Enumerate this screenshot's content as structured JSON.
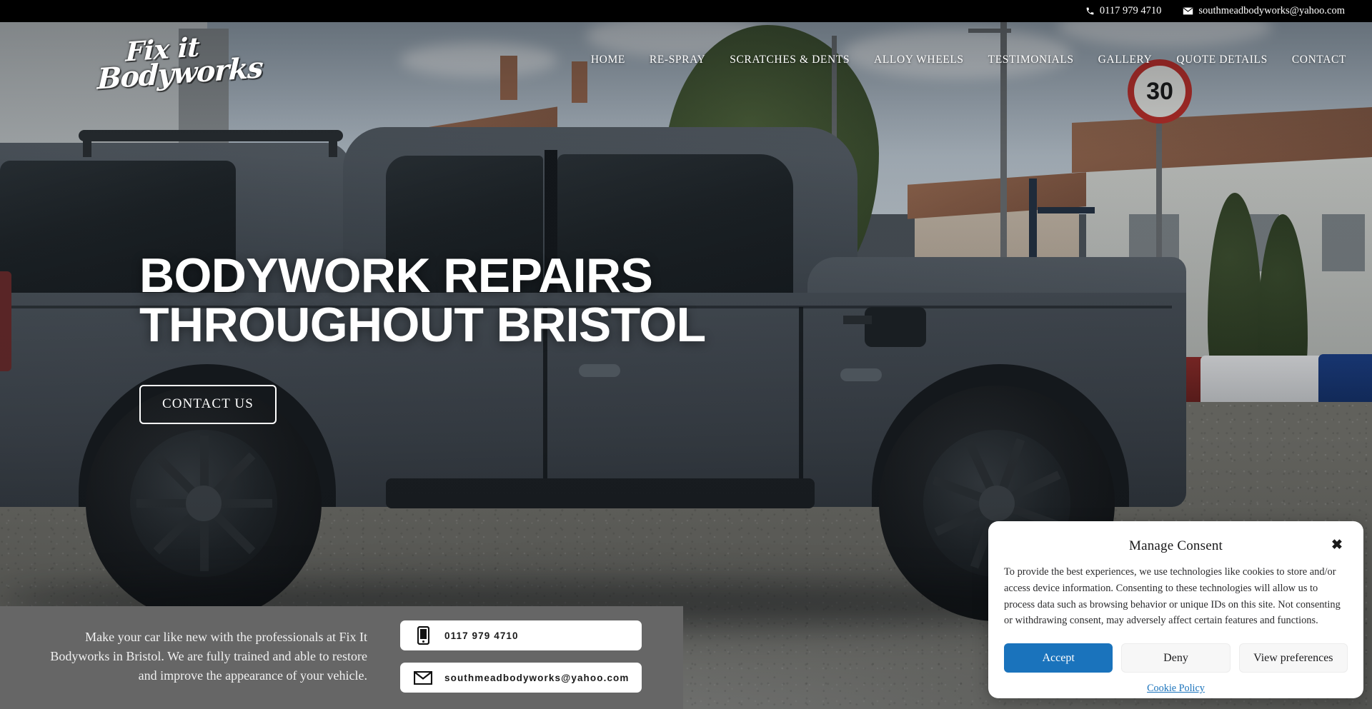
{
  "topbar": {
    "phone": "0117 979 4710",
    "email": "southmeadbodyworks@yahoo.com",
    "phone_icon": "phone-icon",
    "email_icon": "envelope-icon"
  },
  "header": {
    "logo_line1": "Fix it",
    "logo_line2": "Bodyworks",
    "nav": [
      {
        "label": "HOME"
      },
      {
        "label": "RE-SPRAY"
      },
      {
        "label": "SCRATCHES & DENTS"
      },
      {
        "label": "ALLOY WHEELS"
      },
      {
        "label": "TESTIMONIALS"
      },
      {
        "label": "GALLERY"
      },
      {
        "label": "QUOTE DETAILS"
      },
      {
        "label": "CONTACT"
      }
    ]
  },
  "hero": {
    "title_line1": "BODYWORK REPAIRS",
    "title_line2": "THROUGHOUT BRISTOL",
    "cta_label": "CONTACT US",
    "speed_sign": "30"
  },
  "bottom": {
    "blurb": "Make your car like new with the professionals at Fix It Bodyworks in Bristol. We are fully trained and able to restore and improve the appearance of your vehicle.",
    "phone_card": "0117 979 4710",
    "email_card": "southmeadbodyworks@yahoo.com",
    "phone_card_icon": "mobile-phone-icon",
    "email_card_icon": "envelope-icon",
    "panel_color": "#666666"
  },
  "consent": {
    "title": "Manage Consent",
    "close_icon": "close-icon",
    "body": "To provide the best experiences, we use technologies like cookies to store and/or access device information. Consenting to these technologies will allow us to process data such as browsing behavior or unique IDs on this site. Not consenting or withdrawing consent, may adversely affect certain features and functions.",
    "accept_label": "Accept",
    "deny_label": "Deny",
    "preferences_label": "View preferences",
    "policy_label": "Cookie Policy",
    "accept_color": "#1a73bc"
  }
}
